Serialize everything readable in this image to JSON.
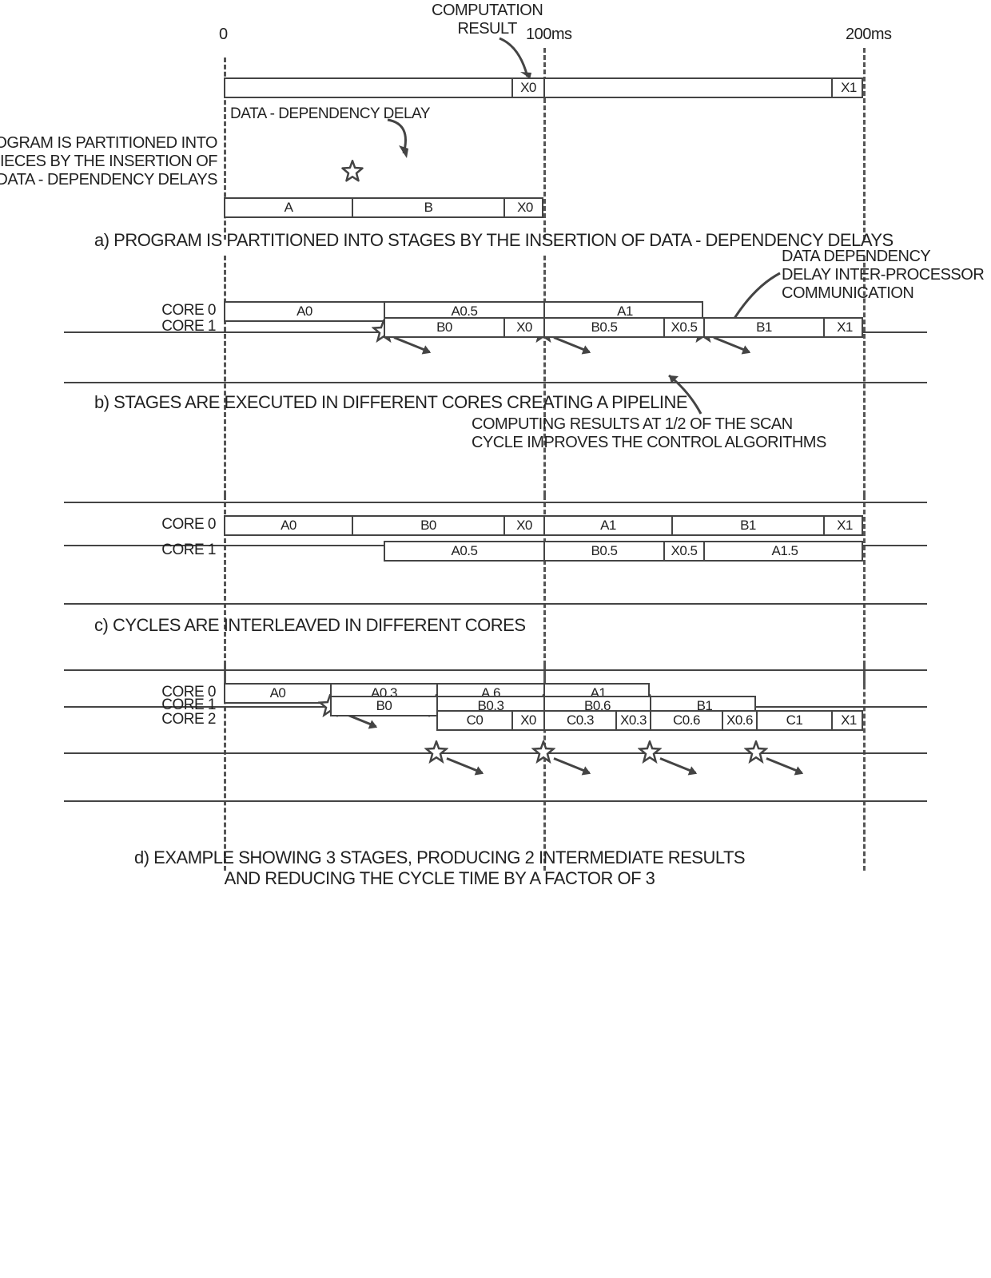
{
  "timeline": {
    "t0": "0",
    "t100": "100ms",
    "t200": "200ms"
  },
  "annot": {
    "comp_result": "COMPUTATION\nRESULT",
    "dep_delay": "DATA - DEPENDENCY DELAY",
    "partition_side": "PROGRAM IS PARTITIONED INTO\nPIECES BY THE INSERTION OF\nDATA - DEPENDENCY DELAYS",
    "ipc": "DATA DEPENDENCY\nDELAY INTER-PROCESSOR\nCOMMUNICATION",
    "half_cycle": "COMPUTING RESULTS AT 1/2 OF THE SCAN\nCYCLE IMPROVES THE CONTROL ALGORITHMS"
  },
  "a": {
    "top": {
      "x0": "X0",
      "x1": "X1"
    },
    "bot": {
      "a": "A",
      "b": "B",
      "x0": "X0"
    },
    "caption": "a) PROGRAM IS PARTITIONED INTO STAGES BY THE INSERTION OF DATA - DEPENDENCY DELAYS"
  },
  "b": {
    "core0": "CORE 0",
    "core1": "CORE 1",
    "r0": {
      "a0": "A0",
      "a05": "A0.5",
      "a1": "A1"
    },
    "r1": {
      "b0": "B0",
      "x0": "X0",
      "b05": "B0.5",
      "x05": "X0.5",
      "b1": "B1",
      "x1": "X1"
    },
    "caption": "b) STAGES ARE EXECUTED IN DIFFERENT CORES CREATING A PIPELINE"
  },
  "c": {
    "core0": "CORE 0",
    "core1": "CORE 1",
    "r0": {
      "a0": "A0",
      "b0": "B0",
      "x0": "X0",
      "a1": "A1",
      "b1": "B1",
      "x1": "X1"
    },
    "r1": {
      "a05": "A0.5",
      "b05": "B0.5",
      "x05": "X0.5",
      "a15": "A1.5"
    },
    "caption": "c) CYCLES ARE INTERLEAVED IN DIFFERENT CORES"
  },
  "d": {
    "core0": "CORE 0",
    "core1": "CORE 1",
    "core2": "CORE 2",
    "r0": {
      "a0": "A0",
      "a03": "A0.3",
      "a6": "A.6",
      "a1": "A1"
    },
    "r1": {
      "b0": "B0",
      "b03": "B0.3",
      "b06": "B0.6",
      "b1": "B1"
    },
    "r2": {
      "c0": "C0",
      "x0": "X0",
      "c03": "C0.3",
      "x03": "X0.3",
      "c06": "C0.6",
      "x06": "X0.6",
      "c1": "C1",
      "x1": "X1"
    },
    "caption": "d) EXAMPLE SHOWING 3 STAGES, PRODUCING 2 INTERMEDIATE RESULTS\nAND REDUCING THE CYCLE TIME BY A FACTOR OF 3"
  },
  "chart_data": {
    "type": "timeline",
    "time_axis_ms": [
      0,
      100,
      200
    ],
    "unit_ms": 100,
    "panels": [
      {
        "id": "a",
        "bars": [
          {
            "lane": "result",
            "segments": [
              {
                "label": "",
                "start": 0,
                "end": 90
              },
              {
                "label": "X0",
                "start": 90,
                "end": 100
              },
              {
                "label": "",
                "start": 100,
                "end": 190
              },
              {
                "label": "X1",
                "start": 190,
                "end": 200
              }
            ]
          },
          {
            "lane": "program",
            "segments": [
              {
                "label": "A",
                "start": 0,
                "end": 40
              },
              {
                "label": "B",
                "start": 40,
                "end": 88
              },
              {
                "label": "X0",
                "start": 88,
                "end": 100
              }
            ]
          }
        ],
        "events": [
          {
            "type": "dep-delay",
            "t": 40
          }
        ]
      },
      {
        "id": "b",
        "bars": [
          {
            "lane": "CORE 0",
            "segments": [
              {
                "label": "A0",
                "start": 0,
                "end": 50
              },
              {
                "label": "A0.5",
                "start": 50,
                "end": 100
              },
              {
                "label": "A1",
                "start": 100,
                "end": 150
              }
            ]
          },
          {
            "lane": "CORE 1",
            "segments": [
              {
                "label": "B0",
                "start": 50,
                "end": 88
              },
              {
                "label": "X0",
                "start": 88,
                "end": 100
              },
              {
                "label": "B0.5",
                "start": 100,
                "end": 138
              },
              {
                "label": "X0.5",
                "start": 138,
                "end": 150
              },
              {
                "label": "B1",
                "start": 150,
                "end": 188
              },
              {
                "label": "X1",
                "start": 188,
                "end": 200
              }
            ]
          }
        ],
        "events": [
          {
            "type": "ipc",
            "t": 50
          },
          {
            "type": "ipc",
            "t": 100
          },
          {
            "type": "ipc",
            "t": 150
          }
        ]
      },
      {
        "id": "c",
        "bars": [
          {
            "lane": "CORE 0",
            "segments": [
              {
                "label": "A0",
                "start": 0,
                "end": 40
              },
              {
                "label": "B0",
                "start": 40,
                "end": 88
              },
              {
                "label": "X0",
                "start": 88,
                "end": 100
              },
              {
                "label": "A1",
                "start": 100,
                "end": 140
              },
              {
                "label": "B1",
                "start": 140,
                "end": 188
              },
              {
                "label": "X1",
                "start": 188,
                "end": 200
              }
            ]
          },
          {
            "lane": "CORE 1",
            "segments": [
              {
                "label": "A0.5",
                "start": 50,
                "end": 100
              },
              {
                "label": "B0.5",
                "start": 100,
                "end": 138
              },
              {
                "label": "X0.5",
                "start": 138,
                "end": 150
              },
              {
                "label": "A1.5",
                "start": 150,
                "end": 200
              }
            ]
          }
        ]
      },
      {
        "id": "d",
        "bars": [
          {
            "lane": "CORE 0",
            "segments": [
              {
                "label": "A0",
                "start": 0,
                "end": 33
              },
              {
                "label": "A0.3",
                "start": 33,
                "end": 66
              },
              {
                "label": "A.6",
                "start": 66,
                "end": 100
              },
              {
                "label": "A1",
                "start": 100,
                "end": 133
              }
            ]
          },
          {
            "lane": "CORE 1",
            "segments": [
              {
                "label": "B0",
                "start": 33,
                "end": 66
              },
              {
                "label": "B0.3",
                "start": 66,
                "end": 100
              },
              {
                "label": "B0.6",
                "start": 100,
                "end": 133
              },
              {
                "label": "B1",
                "start": 133,
                "end": 166
              }
            ]
          },
          {
            "lane": "CORE 2",
            "segments": [
              {
                "label": "C0",
                "start": 66,
                "end": 90
              },
              {
                "label": "X0",
                "start": 90,
                "end": 100
              },
              {
                "label": "C0.3",
                "start": 100,
                "end": 123
              },
              {
                "label": "X0.3",
                "start": 123,
                "end": 133
              },
              {
                "label": "C0.6",
                "start": 133,
                "end": 156
              },
              {
                "label": "X0.6",
                "start": 156,
                "end": 166
              },
              {
                "label": "C1",
                "start": 166,
                "end": 190
              },
              {
                "label": "X1",
                "start": 190,
                "end": 200
              }
            ]
          }
        ],
        "events": [
          {
            "type": "ipc",
            "from": "CORE 0",
            "to": "CORE 1",
            "t": 33
          },
          {
            "type": "ipc",
            "from": "CORE 0",
            "to": "CORE 1",
            "t": 66
          },
          {
            "type": "ipc",
            "from": "CORE 0",
            "to": "CORE 1",
            "t": 100
          },
          {
            "type": "ipc",
            "from": "CORE 0",
            "to": "CORE 1",
            "t": 133
          },
          {
            "type": "ipc",
            "from": "CORE 1",
            "to": "CORE 2",
            "t": 66
          },
          {
            "type": "ipc",
            "from": "CORE 1",
            "to": "CORE 2",
            "t": 100
          },
          {
            "type": "ipc",
            "from": "CORE 1",
            "to": "CORE 2",
            "t": 133
          },
          {
            "type": "ipc",
            "from": "CORE 1",
            "to": "CORE 2",
            "t": 166
          }
        ]
      }
    ]
  }
}
